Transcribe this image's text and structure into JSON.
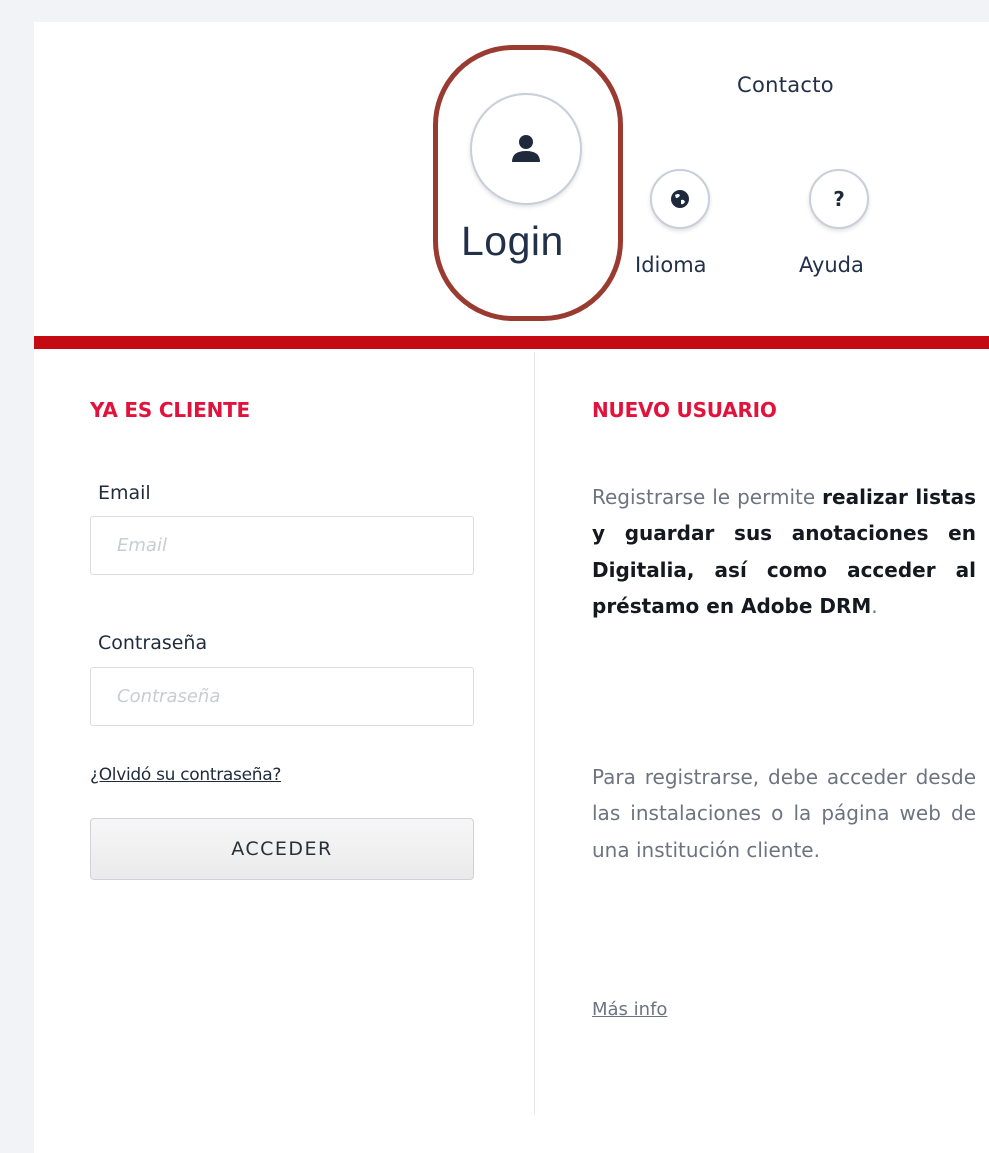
{
  "header": {
    "contact_label": "Contacto",
    "login_label": "Login",
    "language_label": "Idioma",
    "help_label": "Ayuda",
    "help_icon_text": "?",
    "highlight_color": "#9a3b32"
  },
  "brand": {
    "accent_red": "#c40a12",
    "title_color": "#e1133c"
  },
  "login_section": {
    "title": "YA ES CLIENTE",
    "email_label": "Email",
    "email_placeholder": "Email",
    "email_value": "",
    "password_label": "Contraseña",
    "password_placeholder": "Contraseña",
    "password_value": "",
    "forgot_label": "¿Olvidó su contraseña?",
    "submit_label": "ACCEDER"
  },
  "new_user_section": {
    "title": "NUEVO USUARIO",
    "para1_plain": "Registrarse le permite ",
    "para1_bold": "realizar listas y guardar sus anotaciones en Digitalia, así como acceder al préstamo en Adobe DRM",
    "para1_end": ".",
    "para2": "Para registrarse, debe acceder desde las instalaciones o la página web de una institución cliente.",
    "more_info_label": "Más info"
  },
  "icons": [
    "user-icon",
    "globe-icon",
    "help-icon"
  ]
}
